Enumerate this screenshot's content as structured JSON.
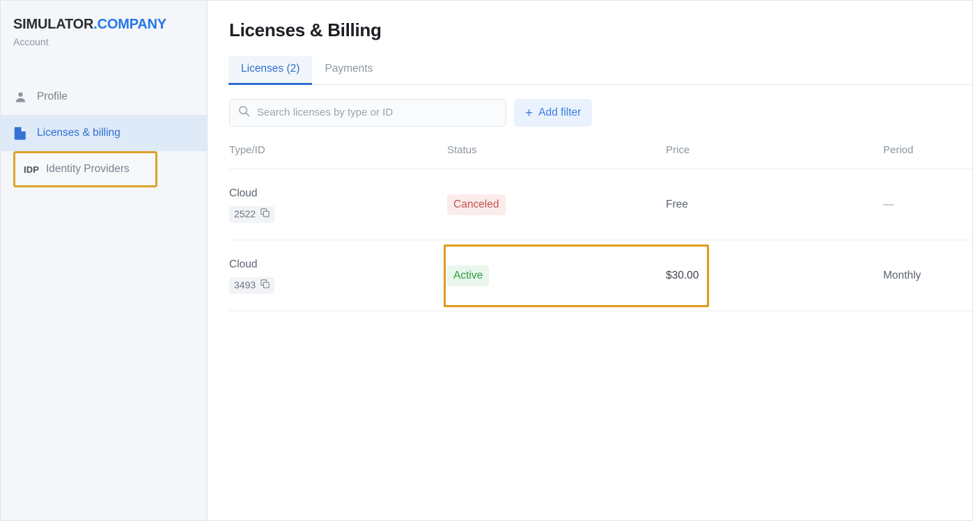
{
  "sidebar": {
    "brand": {
      "main": "SIMULATOR",
      "accent": ".COMPANY",
      "subtitle": "Account"
    },
    "items": [
      {
        "label": "Profile",
        "icon": "user-icon"
      },
      {
        "label": "Licenses & billing",
        "icon": "document-icon"
      },
      {
        "label": "Identity Providers",
        "icon": "idp-tag",
        "tag": "IDP"
      }
    ]
  },
  "main": {
    "title": "Licenses & Billing",
    "tabs": [
      {
        "label": "Licenses (2)"
      },
      {
        "label": "Payments"
      }
    ],
    "search": {
      "placeholder": "Search licenses by type or ID",
      "value": "",
      "icon": "search-icon"
    },
    "add_filter": {
      "label": "Add filter",
      "icon": "plus-icon"
    },
    "table": {
      "columns": [
        "Type/ID",
        "Status",
        "Price",
        "Period"
      ],
      "rows": [
        {
          "type": "Cloud",
          "id": "2522",
          "copy_icon": "copy-icon",
          "status": "Canceled",
          "status_kind": "canceled",
          "price": "Free",
          "period": "—"
        },
        {
          "type": "Cloud",
          "id": "3493",
          "copy_icon": "copy-icon",
          "status": "Active",
          "status_kind": "active",
          "price": "$30.00",
          "period": "Monthly"
        }
      ]
    }
  },
  "colors": {
    "brand_accent": "#2477e8",
    "nav_active_bg": "#dfeaf9",
    "nav_active_text": "#2f6fd0",
    "highlight_border": "#df9c1b",
    "badge_canceled_text": "#c4524f",
    "badge_canceled_bg": "#fbeceb",
    "badge_active_text": "#2e9e3e",
    "badge_active_bg": "#e9f6ec",
    "link_blue": "#3b7ddd"
  }
}
